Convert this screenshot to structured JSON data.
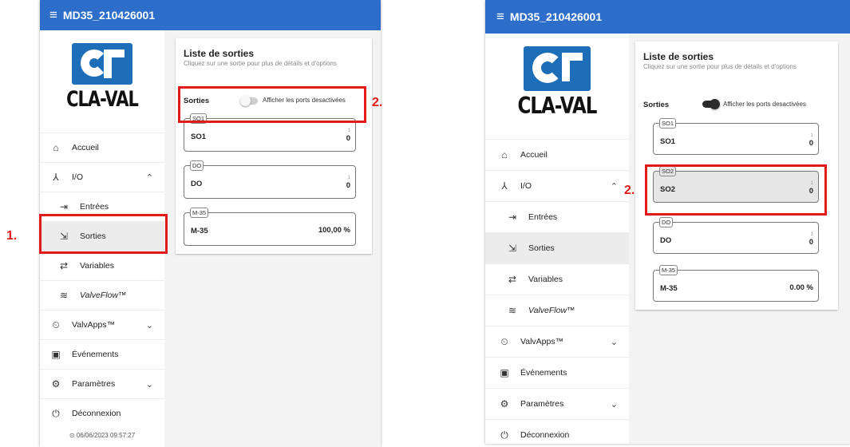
{
  "left_panel": {
    "title": "MD35_210426001",
    "logo_text": "CLA-VAL",
    "menu": {
      "accueil": "Accueil",
      "io": "I/O",
      "entrees": "Entrées",
      "sorties": "Sorties",
      "variables": "Variables",
      "valveflow": "ValveFlow™",
      "valvapps": "ValvApps™",
      "evenements": "Événements",
      "parametres": "Paramètres",
      "deconnexion": "Déconnexion"
    },
    "datetime": "⊙ 06/06/2023 09:57:27",
    "card": {
      "title": "Liste de sorties",
      "subtitle": "Cliquez sur une sortie pour plus de détails et d'options",
      "sorties_label": "Sorties",
      "toggle_label": "Afficher les ports desactivées",
      "toggle_on": false
    },
    "ports": [
      {
        "tag": "SO1",
        "name": "SO1",
        "num": "1",
        "value": "0"
      },
      {
        "tag": "DO",
        "name": "DO",
        "num": "1",
        "value": "0"
      },
      {
        "tag": "M-35",
        "name": "M-35",
        "num": "",
        "value": "100,00 %"
      }
    ]
  },
  "right_panel": {
    "title": "MD35_210426001",
    "logo_text": "CLA-VAL",
    "menu": {
      "accueil": "Accueil",
      "io": "I/O",
      "entrees": "Entrées",
      "sorties": "Sorties",
      "variables": "Variables",
      "valveflow": "ValveFlow™",
      "valvapps": "ValvApps™",
      "evenements": "Événements",
      "parametres": "Paramètres",
      "deconnexion": "Déconnexion"
    },
    "card": {
      "title": "Liste de sorties",
      "subtitle": "Cliquez sur une sortie pour plus de détails et d'options",
      "sorties_label": "Sorties",
      "toggle_label": "Afficher les ports desactivées",
      "toggle_on": true
    },
    "ports": [
      {
        "tag": "SO1",
        "name": "SO1",
        "num": "1",
        "value": "0"
      },
      {
        "tag": "SO2",
        "name": "SO2",
        "num": "1",
        "value": "0"
      },
      {
        "tag": "DO",
        "name": "DO",
        "num": "1",
        "value": "0"
      },
      {
        "tag": "M-35",
        "name": "M-35",
        "num": "",
        "value": "0.00 %"
      }
    ]
  },
  "annotations": {
    "step1": "1.",
    "step2": "2.",
    "color": "#e21a1a"
  },
  "colors": {
    "topbar": "#2e6ecb",
    "logo_blue": "#1e6db8"
  }
}
